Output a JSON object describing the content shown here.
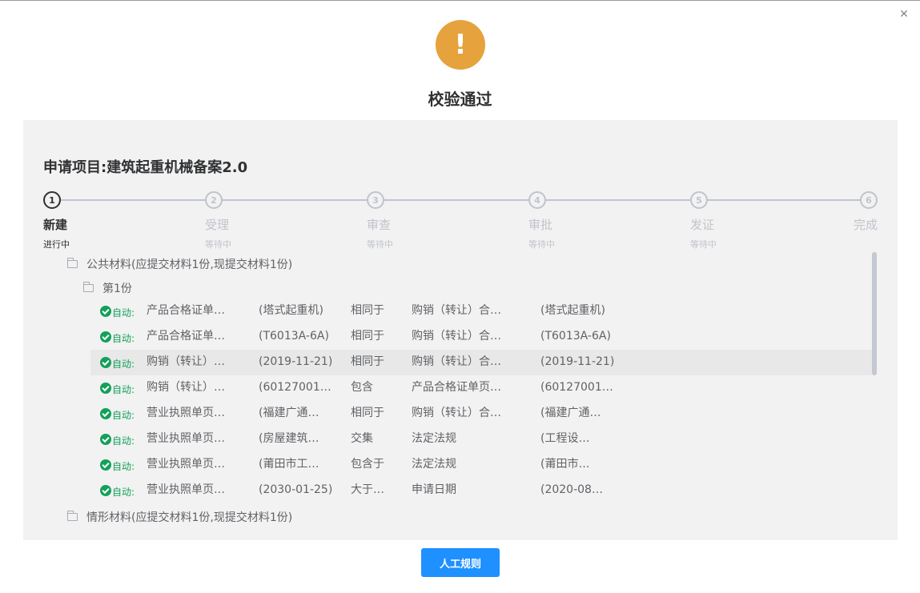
{
  "dialog": {
    "close_icon": "close-icon",
    "close_glyph": "✕",
    "status_icon": "warning-icon",
    "status_glyph": "!",
    "status_color": "#e6a23c",
    "title": "校验通过"
  },
  "project": {
    "label": "申请项目:",
    "name": "建筑起重机械备案2.0"
  },
  "steps": [
    {
      "num": "1",
      "title": "新建",
      "desc": "进行中",
      "active": true
    },
    {
      "num": "2",
      "title": "受理",
      "desc": "等待中",
      "active": false
    },
    {
      "num": "3",
      "title": "审查",
      "desc": "等待中",
      "active": false
    },
    {
      "num": "4",
      "title": "审批",
      "desc": "等待中",
      "active": false
    },
    {
      "num": "5",
      "title": "发证",
      "desc": "等待中",
      "active": false
    },
    {
      "num": "6",
      "title": "完成",
      "desc": "",
      "active": false
    }
  ],
  "tree": {
    "group1": {
      "label": "公共材料(应提交材料1份,现提交材料1份)",
      "icon": "folder-icon"
    },
    "subgroup": {
      "label": "第1份",
      "icon": "folder-icon"
    },
    "rules": [
      {
        "status": "自动:",
        "material": "产品合格证单…",
        "value": "(塔式起重机)",
        "op": "相同于",
        "target": "购销（转让）合…",
        "target_value": "(塔式起重机)",
        "highlight": false
      },
      {
        "status": "自动:",
        "material": "产品合格证单…",
        "value": "(T6013A-6A)",
        "op": "相同于",
        "target": "购销（转让）合…",
        "target_value": "(T6013A-6A)",
        "highlight": false
      },
      {
        "status": "自动:",
        "material": "购销（转让）…",
        "value": "(2019-11-21)",
        "op": "相同于",
        "target": "购销（转让）合…",
        "target_value": "(2019-11-21)",
        "highlight": true
      },
      {
        "status": "自动:",
        "material": "购销（转让）…",
        "value": "(60127001…",
        "op": "包含",
        "target": "产品合格证单页…",
        "target_value": "(60127001…",
        "highlight": false
      },
      {
        "status": "自动:",
        "material": "营业执照单页…",
        "value": "(福建广通…",
        "op": "相同于",
        "target": "购销（转让）合…",
        "target_value": "(福建广通…",
        "highlight": false
      },
      {
        "status": "自动:",
        "material": "营业执照单页…",
        "value": "(房屋建筑…",
        "op": "交集",
        "target": "法定法规",
        "target_value": "(工程设…",
        "highlight": false
      },
      {
        "status": "自动:",
        "material": "营业执照单页…",
        "value": "(莆田市工…",
        "op": "包含于",
        "target": "法定法规",
        "target_value": "(莆田市…",
        "highlight": false
      },
      {
        "status": "自动:",
        "material": "营业执照单页…",
        "value": "(2030-01-25)",
        "op": "大于…",
        "target": "申请日期",
        "target_value": "(2020-08…",
        "highlight": false
      }
    ],
    "group2": {
      "label": "情形材料(应提交材料1份,现提交材料1份)",
      "icon": "folder-icon"
    }
  },
  "footer": {
    "button_label": "人工规则",
    "button_color": "#1e90ff"
  }
}
